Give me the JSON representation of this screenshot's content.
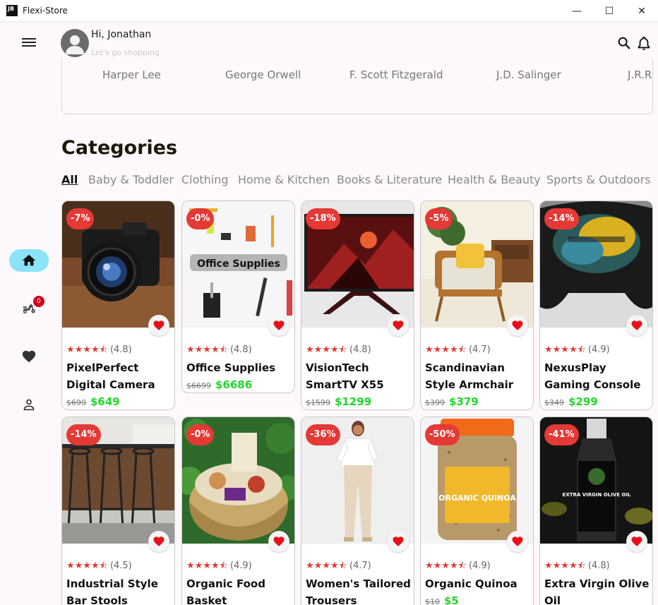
{
  "window": {
    "app_icon_text": "JB",
    "title": "Flexi-Store",
    "minimize": "—",
    "maximize": "☐",
    "close": "✕"
  },
  "header": {
    "greeting": "Hi, Jonathan",
    "subtitle": "Let's go shopping"
  },
  "rail": {
    "cart_badge": "0"
  },
  "authors": [
    "Harper Lee",
    "George Orwell",
    "F. Scott Fitzgerald",
    "J.D. Salinger",
    "J.R.R."
  ],
  "categories": {
    "title": "Categories",
    "tabs": [
      "All",
      "Baby & Toddler",
      "Clothing",
      "Home & Kitchen",
      "Books & Literature",
      "Health & Beauty",
      "Sports & Outdoors"
    ]
  },
  "products": [
    {
      "discount": "-7%",
      "stars": "★★★★⯪",
      "rating": "(4.8)",
      "name": "PixelPerfect Digital Camera",
      "old_price": "$699",
      "price": "$649"
    },
    {
      "discount": "-0%",
      "stars": "★★★★⯪",
      "rating": "(4.8)",
      "name": "Office Supplies",
      "old_price": "$6699",
      "price": "$6686",
      "image_label": "Office Supplies"
    },
    {
      "discount": "-18%",
      "stars": "★★★★⯪",
      "rating": "(4.8)",
      "name": "VisionTech SmartTV X55",
      "old_price": "$1599",
      "price": "$1299"
    },
    {
      "discount": "-5%",
      "stars": "★★★★⯪",
      "rating": "(4.7)",
      "name": "Scandinavian Style Armchair",
      "old_price": "$399",
      "price": "$379"
    },
    {
      "discount": "-14%",
      "stars": "★★★★⯪",
      "rating": "(4.9)",
      "name": "NexusPlay Gaming Console",
      "old_price": "$349",
      "price": "$299"
    },
    {
      "discount": "-14%",
      "stars": "★★★★⯪",
      "rating": "(4.5)",
      "name": "Industrial Style Bar Stools",
      "old_price": "",
      "price": ""
    },
    {
      "discount": "-0%",
      "stars": "★★★★⯪",
      "rating": "(4.9)",
      "name": "Organic Food Basket",
      "old_price": "",
      "price": ""
    },
    {
      "discount": "-36%",
      "stars": "★★★★⯪",
      "rating": "(4.7)",
      "name": "Women's Tailored Trousers",
      "old_price": "",
      "price": ""
    },
    {
      "discount": "-50%",
      "stars": "★★★★⯪",
      "rating": "(4.9)",
      "name": "Organic Quinoa",
      "old_price": "$10",
      "price": "$5",
      "image_label": "ORGANIC QUINOA"
    },
    {
      "discount": "-41%",
      "stars": "★★★★⯪",
      "rating": "(4.8)",
      "name": "Extra Virgin Olive Oil",
      "old_price": "",
      "price": "",
      "image_label": "EXTRA VIRGIN OLIVE OIL"
    }
  ],
  "colors": {
    "accent": "#8be3f7",
    "discount": "#e53935",
    "price": "#22d62a",
    "heart": "#e8101a"
  }
}
